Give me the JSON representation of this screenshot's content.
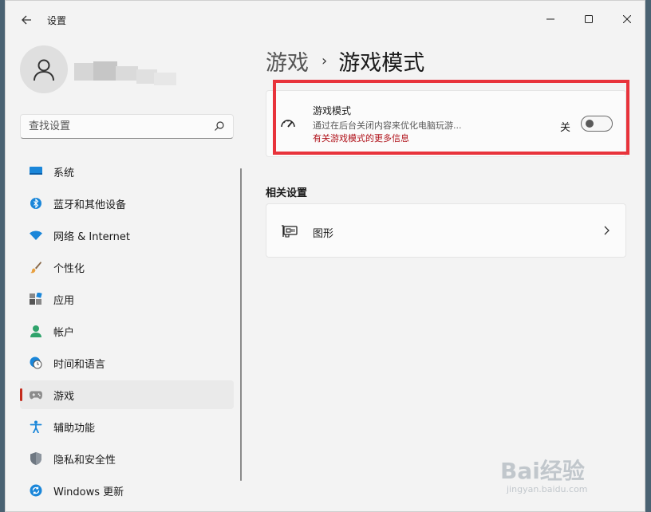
{
  "window": {
    "title": "设置",
    "back_icon": "arrow-left-icon",
    "controls": [
      "minimize-icon",
      "maximize-icon",
      "close-icon"
    ]
  },
  "profile": {
    "avatar_icon": "person-icon"
  },
  "search": {
    "placeholder": "查找设置",
    "icon": "search-icon"
  },
  "sidebar": {
    "items": [
      {
        "label": "系统",
        "icon": "monitor-icon",
        "active": false
      },
      {
        "label": "蓝牙和其他设备",
        "icon": "bluetooth-icon",
        "active": false
      },
      {
        "label": "网络 & Internet",
        "icon": "wifi-icon",
        "active": false
      },
      {
        "label": "个性化",
        "icon": "brush-icon",
        "active": false
      },
      {
        "label": "应用",
        "icon": "apps-icon",
        "active": false
      },
      {
        "label": "帐户",
        "icon": "account-icon",
        "active": false
      },
      {
        "label": "时间和语言",
        "icon": "globe-clock-icon",
        "active": false
      },
      {
        "label": "游戏",
        "icon": "gamepad-icon",
        "active": true
      },
      {
        "label": "辅助功能",
        "icon": "accessibility-icon",
        "active": false
      },
      {
        "label": "隐私和安全性",
        "icon": "shield-icon",
        "active": false
      },
      {
        "label": "Windows 更新",
        "icon": "update-icon",
        "active": false
      }
    ]
  },
  "breadcrumb": {
    "parent": "游戏",
    "separator": "›",
    "current": "游戏模式"
  },
  "game_mode": {
    "title": "游戏模式",
    "description": "通过在后台关闭内容来优化电脑玩游...",
    "link": "有关游戏模式的更多信息",
    "toggle_state": "关",
    "toggle_on": false,
    "icon": "gauge-icon"
  },
  "related": {
    "section_title": "相关设置",
    "items": [
      {
        "label": "图形",
        "icon": "graphics-card-icon"
      }
    ]
  },
  "watermark": {
    "main": "Bai经验",
    "sub": "jingyan.baidu.com"
  },
  "colors": {
    "accent_red": "#c42b1c",
    "highlight_red": "#e8333b",
    "link_red": "#b0121a"
  }
}
